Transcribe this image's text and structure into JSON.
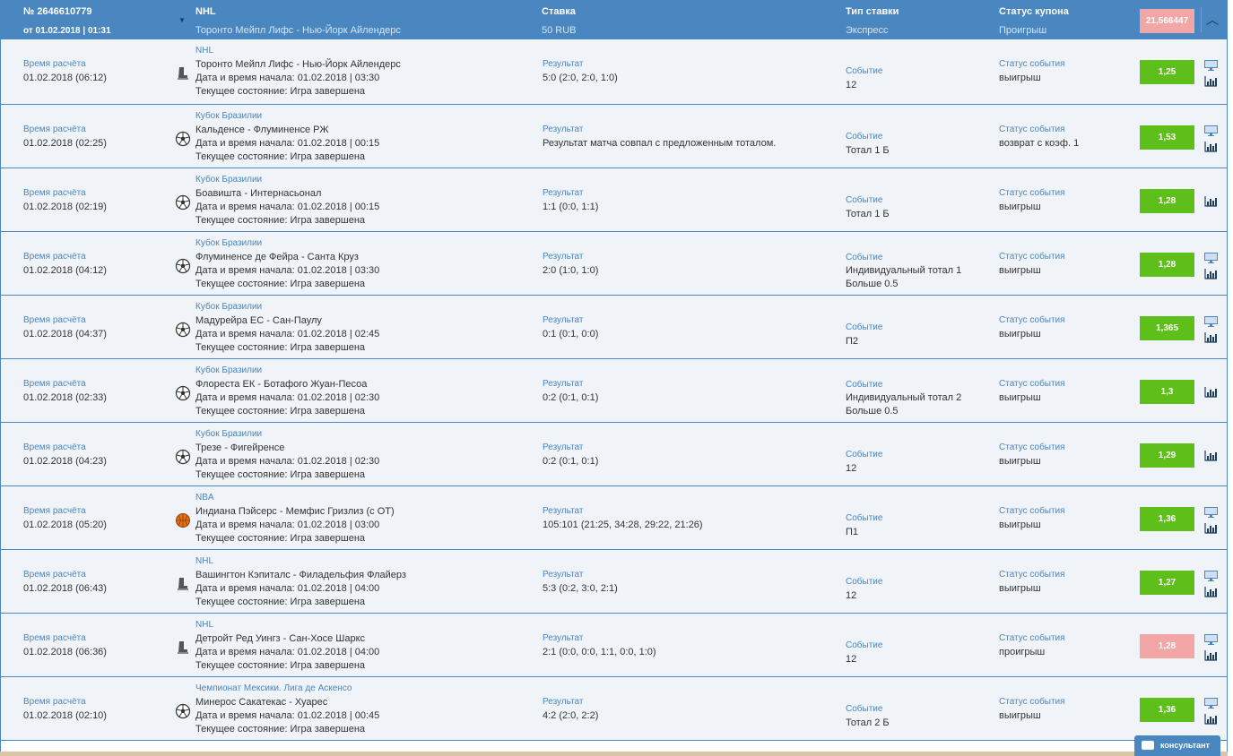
{
  "coupon": {
    "id": "№ 2646610779",
    "date": "от 01.02.2018 | 01:31",
    "league": "NHL",
    "match": "Торонто Мейпл Лифс - Нью-Йорк Айлендерс",
    "stake_label": "Ставка",
    "stake_value": "50 RUB",
    "bet_type_label": "Тип ставки",
    "bet_type_value": "Экспресс",
    "status_label": "Статус купона",
    "status_value": "Проигрыш",
    "total_odds": "21,566447"
  },
  "labels": {
    "calc_time": "Время расчёта",
    "result": "Результат",
    "event": "Событие",
    "event_status": "Статус события"
  },
  "rows": [
    {
      "calc_time": "01.02.2018 (06:12)",
      "league": "NHL",
      "match": "Торонто Мейпл Лифс - Нью-Йорк Айлендерс",
      "start": "Дата и время начала: 01.02.2018 | 03:30",
      "state": "Текущее состояние: Игра завершена",
      "sport": "hockey-icon",
      "result": "5:0 (2:0, 2:0, 1:0)",
      "event": "12",
      "event2": "",
      "status": "выигрыш",
      "odds": "1,25",
      "win": true,
      "monitor": true
    },
    {
      "calc_time": "01.02.2018 (02:25)",
      "league": "Кубок Бразилии",
      "match": "Кальденсе - Флуминенсе РЖ",
      "start": "Дата и время начала: 01.02.2018 | 00:15",
      "state": "Текущее состояние: Игра завершена",
      "sport": "football-icon",
      "result": "Результат матча совпал с предложенным тоталом.",
      "event": "Тотал 1 Б",
      "event2": "",
      "status": "возврат с коэф. 1",
      "odds": "1,53",
      "win": true,
      "monitor": true
    },
    {
      "calc_time": "01.02.2018 (02:19)",
      "league": "Кубок Бразилии",
      "match": "Боавишта - Интернасьонал",
      "start": "Дата и время начала: 01.02.2018 | 00:15",
      "state": "Текущее состояние: Игра завершена",
      "sport": "football-icon",
      "result": "1:1 (0:0, 1:1)",
      "event": "Тотал 1 Б",
      "event2": "",
      "status": "выигрыш",
      "odds": "1,28",
      "win": true,
      "monitor": false
    },
    {
      "calc_time": "01.02.2018 (04:12)",
      "league": "Кубок Бразилии",
      "match": "Флуминенсе де Фейра - Санта Круз",
      "start": "Дата и время начала: 01.02.2018 | 03:30",
      "state": "Текущее состояние: Игра завершена",
      "sport": "football-icon",
      "result": "2:0 (1:0, 1:0)",
      "event": "Индивидуальный тотал 1",
      "event2": "Больше 0.5",
      "status": "выигрыш",
      "odds": "1,28",
      "win": true,
      "monitor": true
    },
    {
      "calc_time": "01.02.2018 (04:37)",
      "league": "Кубок Бразилии",
      "match": "Мадурейра ЕС - Сан-Паулу",
      "start": "Дата и время начала: 01.02.2018 | 02:45",
      "state": "Текущее состояние: Игра завершена",
      "sport": "football-icon",
      "result": "0:1 (0:1, 0:0)",
      "event": "П2",
      "event2": "",
      "status": "выигрыш",
      "odds": "1,365",
      "win": true,
      "monitor": true
    },
    {
      "calc_time": "01.02.2018 (02:33)",
      "league": "Кубок Бразилии",
      "match": "Флореста ЕК - Ботафого Жуан-Песоа",
      "start": "Дата и время начала: 01.02.2018 | 02:30",
      "state": "Текущее состояние: Игра завершена",
      "sport": "football-icon",
      "result": "0:2 (0:1, 0:1)",
      "event": "Индивидуальный тотал 2",
      "event2": "Больше 0.5",
      "status": "выигрыш",
      "odds": "1,3",
      "win": true,
      "monitor": false
    },
    {
      "calc_time": "01.02.2018 (04:23)",
      "league": "Кубок Бразилии",
      "match": "Трезе - Фигейренсе",
      "start": "Дата и время начала: 01.02.2018 | 02:30",
      "state": "Текущее состояние: Игра завершена",
      "sport": "football-icon",
      "result": "0:2 (0:1, 0:1)",
      "event": "12",
      "event2": "",
      "status": "выигрыш",
      "odds": "1,29",
      "win": true,
      "monitor": false
    },
    {
      "calc_time": "01.02.2018 (05:20)",
      "league": "NBA",
      "match": "Индиана Пэйсерс - Мемфис Гризлиз (с ОТ)",
      "start": "Дата и время начала: 01.02.2018 | 03:00",
      "state": "Текущее состояние: Игра завершена",
      "sport": "basketball-icon",
      "result": "105:101 (21:25, 34:28, 29:22, 21:26)",
      "event": "П1",
      "event2": "",
      "status": "выигрыш",
      "odds": "1,36",
      "win": true,
      "monitor": true
    },
    {
      "calc_time": "01.02.2018 (06:43)",
      "league": "NHL",
      "match": "Вашингтон Кэпиталс - Филадельфия Флайерз",
      "start": "Дата и время начала: 01.02.2018 | 04:00",
      "state": "Текущее состояние: Игра завершена",
      "sport": "hockey-icon",
      "result": "5:3 (0:2, 3:0, 2:1)",
      "event": "12",
      "event2": "",
      "status": "выигрыш",
      "odds": "1,27",
      "win": true,
      "monitor": true
    },
    {
      "calc_time": "01.02.2018 (06:36)",
      "league": "NHL",
      "match": "Детройт Ред Уингз - Сан-Хосе Шаркс",
      "start": "Дата и время начала: 01.02.2018 | 04:00",
      "state": "Текущее состояние: Игра завершена",
      "sport": "hockey-icon",
      "result": "2:1 (0:0, 0:0, 1:1, 0:0, 1:0)",
      "event": "12",
      "event2": "",
      "status": "проигрыш",
      "odds": "1,28",
      "win": false,
      "monitor": true
    },
    {
      "calc_time": "01.02.2018 (02:10)",
      "league": "Чемпионат Мексики. Лига де Аскенсо",
      "match": "Минерос Сакатекас - Хуарес",
      "start": "Дата и время начала: 01.02.2018 | 00:45",
      "state": "Текущее состояние: Игра завершена",
      "sport": "football-icon",
      "result": "4:2 (2:0, 2:2)",
      "event": "Тотал 2 Б",
      "event2": "",
      "status": "выигрыш",
      "odds": "1,36",
      "win": true,
      "monitor": true
    }
  ],
  "consultant": "консультант",
  "colors": {
    "header": "#4a86bf",
    "win": "#5fbf1a",
    "lose": "#f2a6a6",
    "row_bg": "#f0f3f7"
  }
}
